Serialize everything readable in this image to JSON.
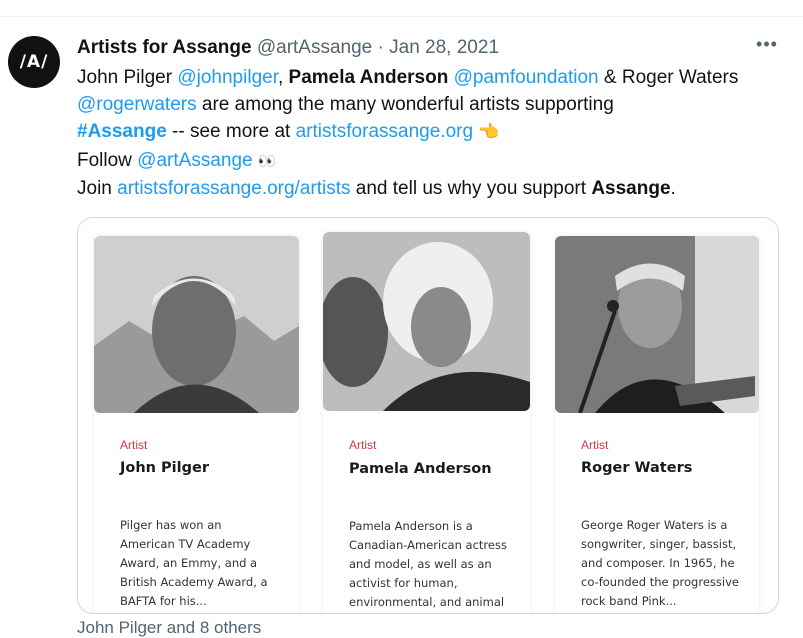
{
  "tweet": {
    "avatar_text": "/A/",
    "display_name": "Artists for Assange",
    "handle": "@artAssange",
    "separator": "·",
    "date": "Jan 28, 2021",
    "more_icon": "more-dots-icon",
    "text": {
      "p1": "John Pilger ",
      "m1": "@johnpilger",
      "p2": ", ",
      "b1": "Pamela Anderson",
      "p3": " ",
      "m2": "@pamfoundation",
      "p4": " & Roger Waters ",
      "m3": "@rogerwaters",
      "p5": " are among the many wonderful artists supporting ",
      "hashtag": "#Assange",
      "p6": " -- see more at ",
      "link1": "artistsforassange.org",
      "emoji1": "👈",
      "follow": "Follow ",
      "m4": "@artAssange",
      "emoji2": "👀",
      "join": "Join ",
      "link2": "artistsforassange.org/artists",
      "p7": " and tell us why you support ",
      "b2": "Assange",
      "p8": "."
    }
  },
  "cards": [
    {
      "kind": "Artist",
      "name": "John Pilger",
      "desc": "Pilger has won an American TV Academy Award, an Emmy, and a British Academy Award, a BAFTA for his..."
    },
    {
      "kind": "Artist",
      "name": "Pamela Anderson",
      "desc": "Pamela Anderson is a Canadian-American actress and model, as well as an activist for human, environmental, and animal rights."
    },
    {
      "kind": "Artist",
      "name": "Roger Waters",
      "desc": "George Roger Waters is a songwriter, singer, bassist, and composer. In 1965, he co-founded the progressive rock band Pink..."
    }
  ],
  "footer": "John Pilger and 8 others"
}
